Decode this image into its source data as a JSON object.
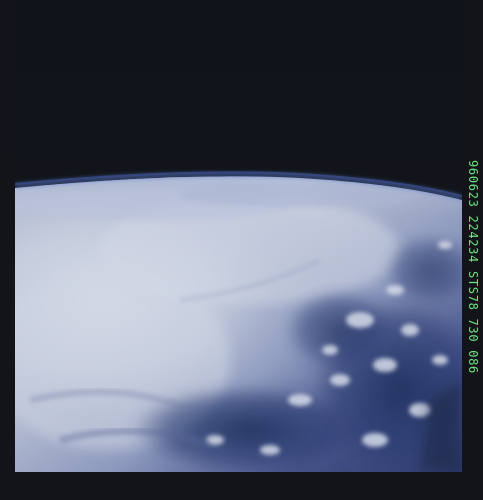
{
  "image": {
    "subject": "earth-limb-cloud-cover-photo"
  },
  "frame_label": {
    "text": "960623 224234 STS78 730 086",
    "color": "#6fe383"
  },
  "colors": {
    "space": "#121419",
    "limb_glow": "#6f8fd6",
    "cloud_light": "#c8cedf",
    "ocean_deep": "#263665"
  }
}
